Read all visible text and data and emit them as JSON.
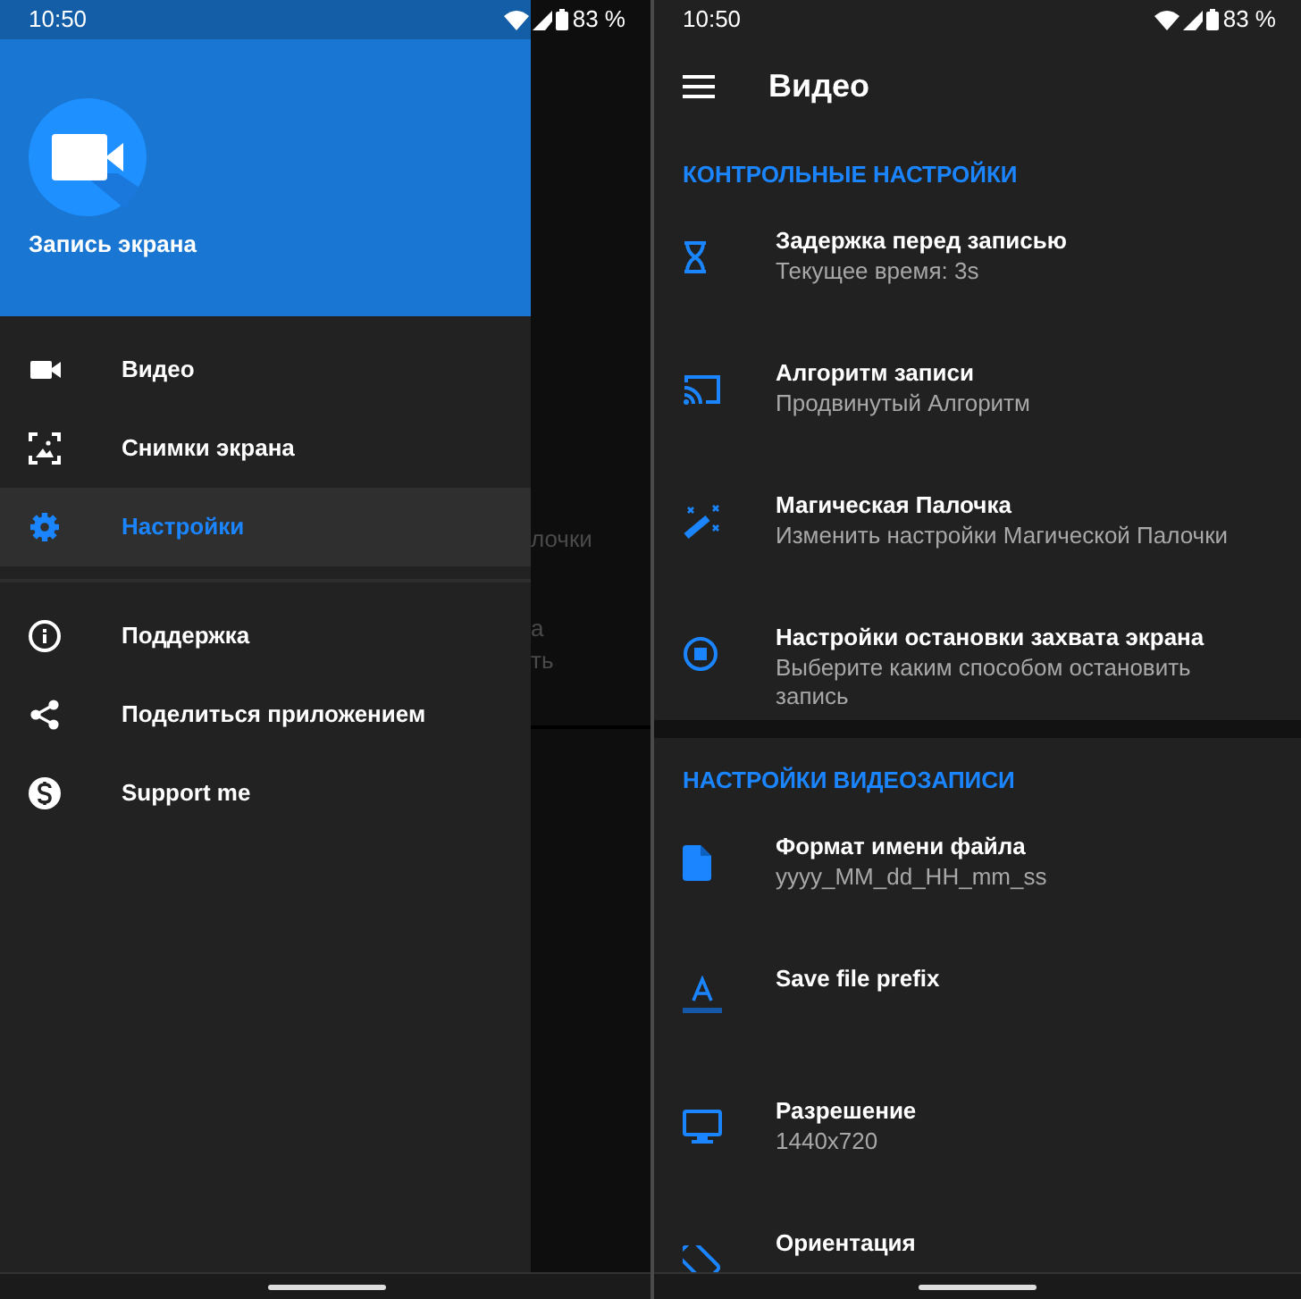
{
  "drawer_screen": {
    "status_bar": {
      "time": "10:50",
      "battery": "83 %"
    },
    "header": {
      "app_name": "Запись экрана"
    },
    "groups": [
      [
        {
          "label": "Видео",
          "selected": false
        },
        {
          "label": "Снимки экрана",
          "selected": false
        },
        {
          "label": "Настройки",
          "selected": true
        }
      ],
      [
        {
          "label": "Поддержка",
          "selected": false
        },
        {
          "label": "Поделиться приложением",
          "selected": false
        },
        {
          "label": "Support me",
          "selected": false
        }
      ]
    ],
    "behind_scrim": [
      "лочки",
      "а",
      "ть"
    ]
  },
  "settings_screen": {
    "status_bar": {
      "time": "10:50",
      "battery": "83 %"
    },
    "title": "Видео",
    "sections": [
      {
        "title": "КОНТРОЛЬНЫЕ НАСТРОЙКИ",
        "items": [
          {
            "title": "Задержка перед записью",
            "summary": "Текущее время: 3s"
          },
          {
            "title": "Алгоритм записи",
            "summary": "Продвинутый Алгоритм"
          },
          {
            "title": "Магическая Палочка",
            "summary": "Изменить настройки Магической Палочки"
          },
          {
            "title": "Настройки остановки захвата экрана",
            "summary": "Выберите каким способом остановить запись"
          }
        ]
      },
      {
        "title": "НАСТРОЙКИ ВИДЕОЗАПИСИ",
        "items": [
          {
            "title": "Формат имени файла",
            "summary": "yyyy_MM_dd_HH_mm_ss"
          },
          {
            "title": "Save file prefix"
          },
          {
            "title": "Разрешение",
            "summary": "1440x720"
          },
          {
            "title": "Ориентация"
          }
        ]
      }
    ]
  }
}
